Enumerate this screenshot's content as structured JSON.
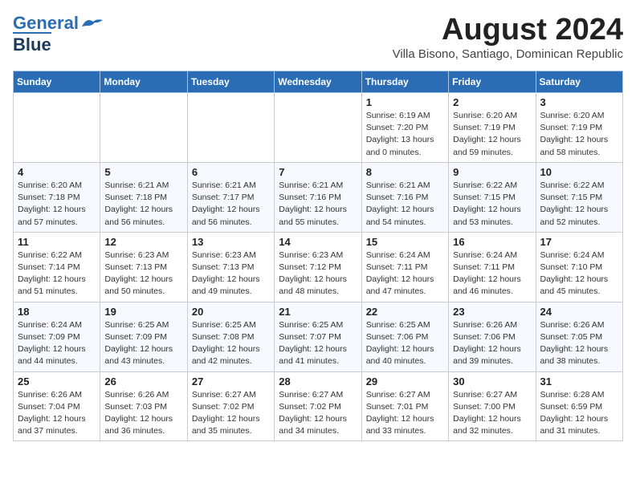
{
  "header": {
    "logo_line1": "General",
    "logo_line2": "Blue",
    "month": "August 2024",
    "location": "Villa Bisono, Santiago, Dominican Republic"
  },
  "weekdays": [
    "Sunday",
    "Monday",
    "Tuesday",
    "Wednesday",
    "Thursday",
    "Friday",
    "Saturday"
  ],
  "weeks": [
    [
      {
        "day": "",
        "content": ""
      },
      {
        "day": "",
        "content": ""
      },
      {
        "day": "",
        "content": ""
      },
      {
        "day": "",
        "content": ""
      },
      {
        "day": "1",
        "content": "Sunrise: 6:19 AM\nSunset: 7:20 PM\nDaylight: 13 hours\nand 0 minutes."
      },
      {
        "day": "2",
        "content": "Sunrise: 6:20 AM\nSunset: 7:19 PM\nDaylight: 12 hours\nand 59 minutes."
      },
      {
        "day": "3",
        "content": "Sunrise: 6:20 AM\nSunset: 7:19 PM\nDaylight: 12 hours\nand 58 minutes."
      }
    ],
    [
      {
        "day": "4",
        "content": "Sunrise: 6:20 AM\nSunset: 7:18 PM\nDaylight: 12 hours\nand 57 minutes."
      },
      {
        "day": "5",
        "content": "Sunrise: 6:21 AM\nSunset: 7:18 PM\nDaylight: 12 hours\nand 56 minutes."
      },
      {
        "day": "6",
        "content": "Sunrise: 6:21 AM\nSunset: 7:17 PM\nDaylight: 12 hours\nand 56 minutes."
      },
      {
        "day": "7",
        "content": "Sunrise: 6:21 AM\nSunset: 7:16 PM\nDaylight: 12 hours\nand 55 minutes."
      },
      {
        "day": "8",
        "content": "Sunrise: 6:21 AM\nSunset: 7:16 PM\nDaylight: 12 hours\nand 54 minutes."
      },
      {
        "day": "9",
        "content": "Sunrise: 6:22 AM\nSunset: 7:15 PM\nDaylight: 12 hours\nand 53 minutes."
      },
      {
        "day": "10",
        "content": "Sunrise: 6:22 AM\nSunset: 7:15 PM\nDaylight: 12 hours\nand 52 minutes."
      }
    ],
    [
      {
        "day": "11",
        "content": "Sunrise: 6:22 AM\nSunset: 7:14 PM\nDaylight: 12 hours\nand 51 minutes."
      },
      {
        "day": "12",
        "content": "Sunrise: 6:23 AM\nSunset: 7:13 PM\nDaylight: 12 hours\nand 50 minutes."
      },
      {
        "day": "13",
        "content": "Sunrise: 6:23 AM\nSunset: 7:13 PM\nDaylight: 12 hours\nand 49 minutes."
      },
      {
        "day": "14",
        "content": "Sunrise: 6:23 AM\nSunset: 7:12 PM\nDaylight: 12 hours\nand 48 minutes."
      },
      {
        "day": "15",
        "content": "Sunrise: 6:24 AM\nSunset: 7:11 PM\nDaylight: 12 hours\nand 47 minutes."
      },
      {
        "day": "16",
        "content": "Sunrise: 6:24 AM\nSunset: 7:11 PM\nDaylight: 12 hours\nand 46 minutes."
      },
      {
        "day": "17",
        "content": "Sunrise: 6:24 AM\nSunset: 7:10 PM\nDaylight: 12 hours\nand 45 minutes."
      }
    ],
    [
      {
        "day": "18",
        "content": "Sunrise: 6:24 AM\nSunset: 7:09 PM\nDaylight: 12 hours\nand 44 minutes."
      },
      {
        "day": "19",
        "content": "Sunrise: 6:25 AM\nSunset: 7:09 PM\nDaylight: 12 hours\nand 43 minutes."
      },
      {
        "day": "20",
        "content": "Sunrise: 6:25 AM\nSunset: 7:08 PM\nDaylight: 12 hours\nand 42 minutes."
      },
      {
        "day": "21",
        "content": "Sunrise: 6:25 AM\nSunset: 7:07 PM\nDaylight: 12 hours\nand 41 minutes."
      },
      {
        "day": "22",
        "content": "Sunrise: 6:25 AM\nSunset: 7:06 PM\nDaylight: 12 hours\nand 40 minutes."
      },
      {
        "day": "23",
        "content": "Sunrise: 6:26 AM\nSunset: 7:06 PM\nDaylight: 12 hours\nand 39 minutes."
      },
      {
        "day": "24",
        "content": "Sunrise: 6:26 AM\nSunset: 7:05 PM\nDaylight: 12 hours\nand 38 minutes."
      }
    ],
    [
      {
        "day": "25",
        "content": "Sunrise: 6:26 AM\nSunset: 7:04 PM\nDaylight: 12 hours\nand 37 minutes."
      },
      {
        "day": "26",
        "content": "Sunrise: 6:26 AM\nSunset: 7:03 PM\nDaylight: 12 hours\nand 36 minutes."
      },
      {
        "day": "27",
        "content": "Sunrise: 6:27 AM\nSunset: 7:02 PM\nDaylight: 12 hours\nand 35 minutes."
      },
      {
        "day": "28",
        "content": "Sunrise: 6:27 AM\nSunset: 7:02 PM\nDaylight: 12 hours\nand 34 minutes."
      },
      {
        "day": "29",
        "content": "Sunrise: 6:27 AM\nSunset: 7:01 PM\nDaylight: 12 hours\nand 33 minutes."
      },
      {
        "day": "30",
        "content": "Sunrise: 6:27 AM\nSunset: 7:00 PM\nDaylight: 12 hours\nand 32 minutes."
      },
      {
        "day": "31",
        "content": "Sunrise: 6:28 AM\nSunset: 6:59 PM\nDaylight: 12 hours\nand 31 minutes."
      }
    ]
  ]
}
